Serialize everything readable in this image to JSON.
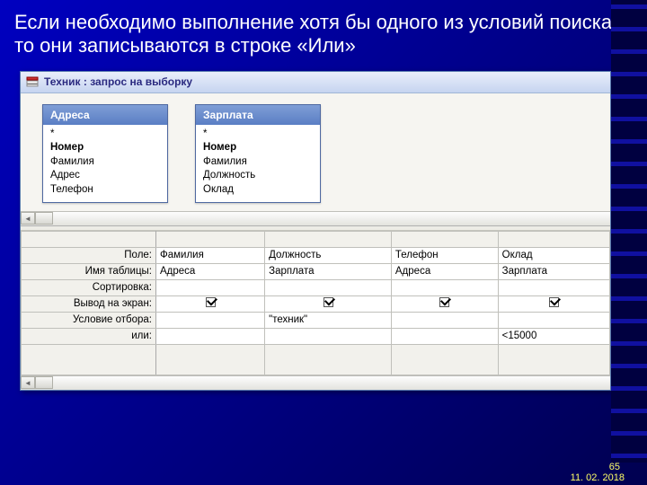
{
  "slide": {
    "title_text": "Если необходимо выполнение хотя бы одного из условий поиска, то они записываются в строке «Или»",
    "slide_num": "65",
    "date": "11. 02. 2018"
  },
  "window": {
    "title": "Техник : запрос на выборку"
  },
  "tables": {
    "t1": {
      "name": "Адреса",
      "fields": {
        "star": "*",
        "f1": "Номер",
        "f2": "Фамилия",
        "f3": "Адрес",
        "f4": "Телефон"
      }
    },
    "t2": {
      "name": "Зарплата",
      "fields": {
        "star": "*",
        "f1": "Номер",
        "f2": "Фамилия",
        "f3": "Должность",
        "f4": "Оклад"
      }
    }
  },
  "grid": {
    "rowlabels": {
      "field": "Поле:",
      "table": "Имя таблицы:",
      "sort": "Сортировка:",
      "show": "Вывод на экран:",
      "criteria": "Условие отбора:",
      "or": "или:"
    },
    "cols": {
      "c1": {
        "field": "Фамилия",
        "table": "Адреса",
        "sort": "",
        "criteria": "",
        "or": ""
      },
      "c2": {
        "field": "Должность",
        "table": "Зарплата",
        "sort": "",
        "criteria": "\"техник\"",
        "or": ""
      },
      "c3": {
        "field": "Телефон",
        "table": "Адреса",
        "sort": "",
        "criteria": "",
        "or": ""
      },
      "c4": {
        "field": "Оклад",
        "table": "Зарплата",
        "sort": "",
        "criteria": "",
        "or": "<15000"
      }
    }
  },
  "scroll": {
    "left_glyph": "◄",
    "right_glyph": "►"
  }
}
